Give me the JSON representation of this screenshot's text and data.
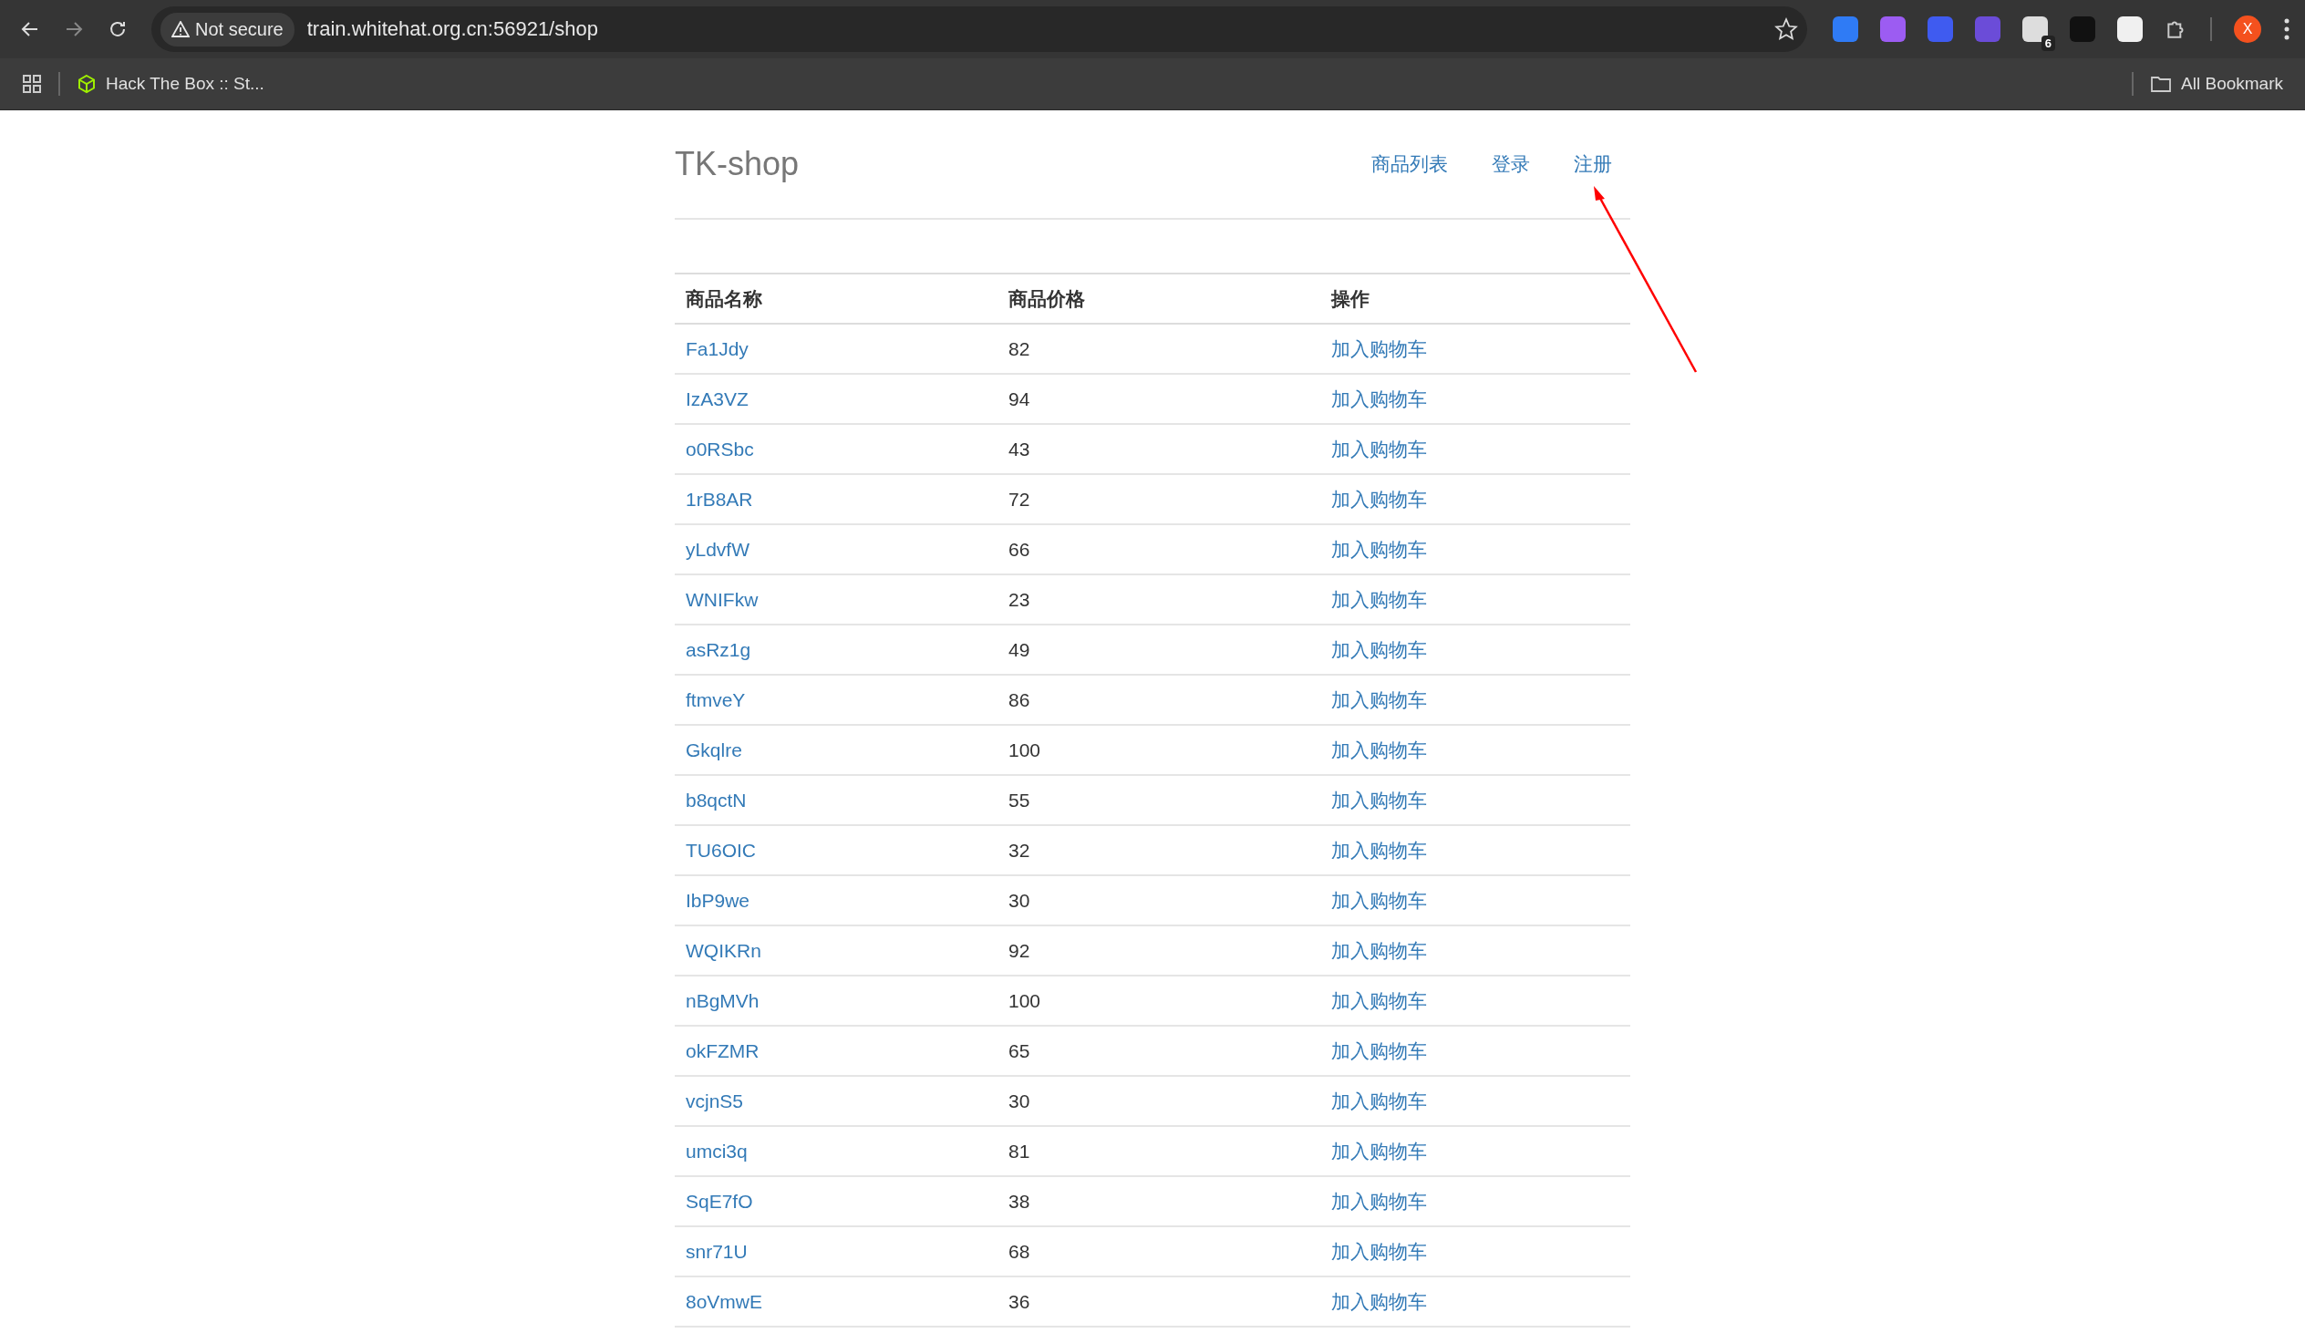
{
  "browser": {
    "security_label": "Not secure",
    "url": "train.whitehat.org.cn:56921/shop",
    "extension_badge": "6",
    "profile_initial": "X",
    "bookmarks": [
      "Hack The Box :: St..."
    ],
    "all_bookmarks": "All Bookmark"
  },
  "site": {
    "title": "TK-shop",
    "nav": [
      "商品列表",
      "登录",
      "注册"
    ]
  },
  "table": {
    "columns": [
      "商品名称",
      "商品价格",
      "操作"
    ],
    "rows": [
      {
        "name": "Fa1Jdy",
        "price": "82",
        "action": "加入购物车"
      },
      {
        "name": "IzA3VZ",
        "price": "94",
        "action": "加入购物车"
      },
      {
        "name": "o0RSbc",
        "price": "43",
        "action": "加入购物车"
      },
      {
        "name": "1rB8AR",
        "price": "72",
        "action": "加入购物车"
      },
      {
        "name": "yLdvfW",
        "price": "66",
        "action": "加入购物车"
      },
      {
        "name": "WNIFkw",
        "price": "23",
        "action": "加入购物车"
      },
      {
        "name": "asRz1g",
        "price": "49",
        "action": "加入购物车"
      },
      {
        "name": "ftmveY",
        "price": "86",
        "action": "加入购物车"
      },
      {
        "name": "Gkqlre",
        "price": "100",
        "action": "加入购物车"
      },
      {
        "name": "b8qctN",
        "price": "55",
        "action": "加入购物车"
      },
      {
        "name": "TU6OIC",
        "price": "32",
        "action": "加入购物车"
      },
      {
        "name": "IbP9we",
        "price": "30",
        "action": "加入购物车"
      },
      {
        "name": "WQIKRn",
        "price": "92",
        "action": "加入购物车"
      },
      {
        "name": "nBgMVh",
        "price": "100",
        "action": "加入购物车"
      },
      {
        "name": "okFZMR",
        "price": "65",
        "action": "加入购物车"
      },
      {
        "name": "vcjnS5",
        "price": "30",
        "action": "加入购物车"
      },
      {
        "name": "umci3q",
        "price": "81",
        "action": "加入购物车"
      },
      {
        "name": "SqE7fO",
        "price": "38",
        "action": "加入购物车"
      },
      {
        "name": "snr71U",
        "price": "68",
        "action": "加入购物车"
      },
      {
        "name": "8oVmwE",
        "price": "36",
        "action": "加入购物车"
      }
    ]
  }
}
